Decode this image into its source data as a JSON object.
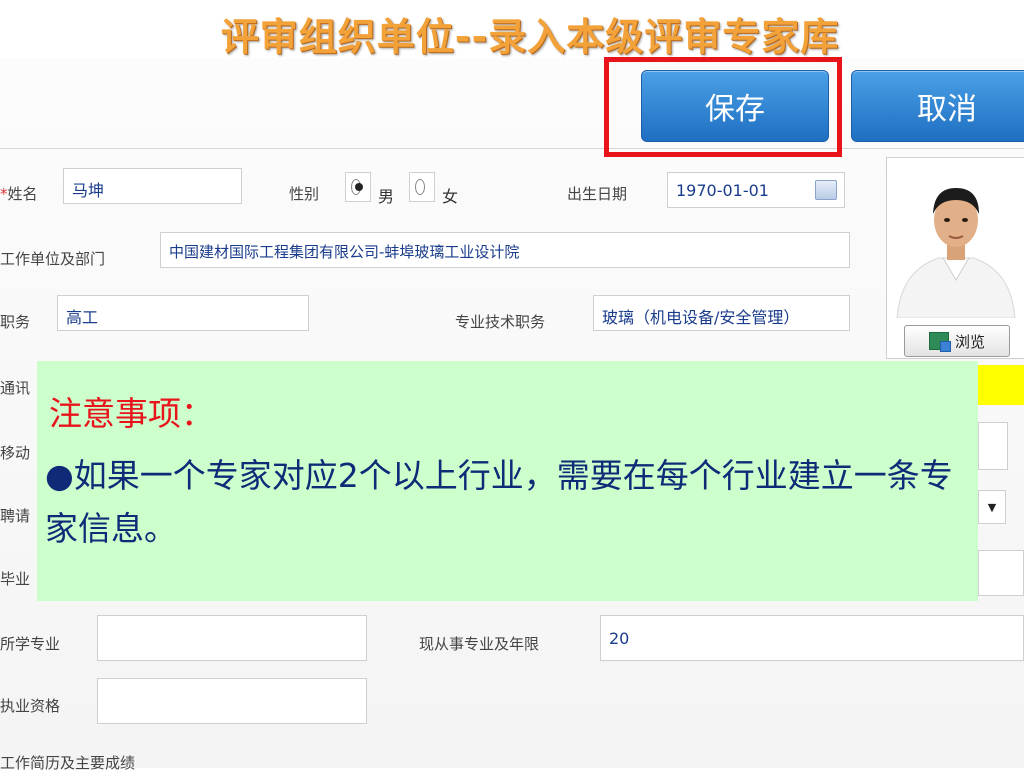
{
  "slide_title": "评审组织单位--录入本级评审专家库",
  "toolbar": {
    "save_label": "保存",
    "cancel_label": "取消"
  },
  "form": {
    "name_label": "姓名",
    "name_value": "马坤",
    "gender_label": "性别",
    "gender_male": "男",
    "gender_female": "女",
    "gender_selected": "男",
    "birth_label": "出生日期",
    "birth_value": "1970-01-01",
    "workplace_label": "工作单位及部门",
    "workplace_value": "中国建材国际工程集团有限公司-蚌埠玻璃工业设计院",
    "position_label": "职务",
    "position_value": "高工",
    "tech_title_label": "专业技术职务",
    "tech_title_value": "玻璃（机电设备/安全管理）",
    "address_label": "通讯",
    "mobile_label": "移动",
    "hire_label": "聘请",
    "graduate_label": "毕业",
    "major_label": "所学专业",
    "major_value": "",
    "years_label": "现从事专业及年限",
    "years_value": "20",
    "qualification_label": "执业资格",
    "qualification_value": "",
    "resume_label": "工作简历及主要成绩"
  },
  "photo": {
    "browse_label": "浏览"
  },
  "notice": {
    "title": "注意事项：",
    "body": "●如果一个专家对应2个以上行业，需要在每个行业建立一条专家信息。"
  },
  "colors": {
    "accent": "#f3a23a",
    "button": "#2a7fd4",
    "highlight": "#e8131b",
    "notice_bg": "#ccffcc"
  }
}
